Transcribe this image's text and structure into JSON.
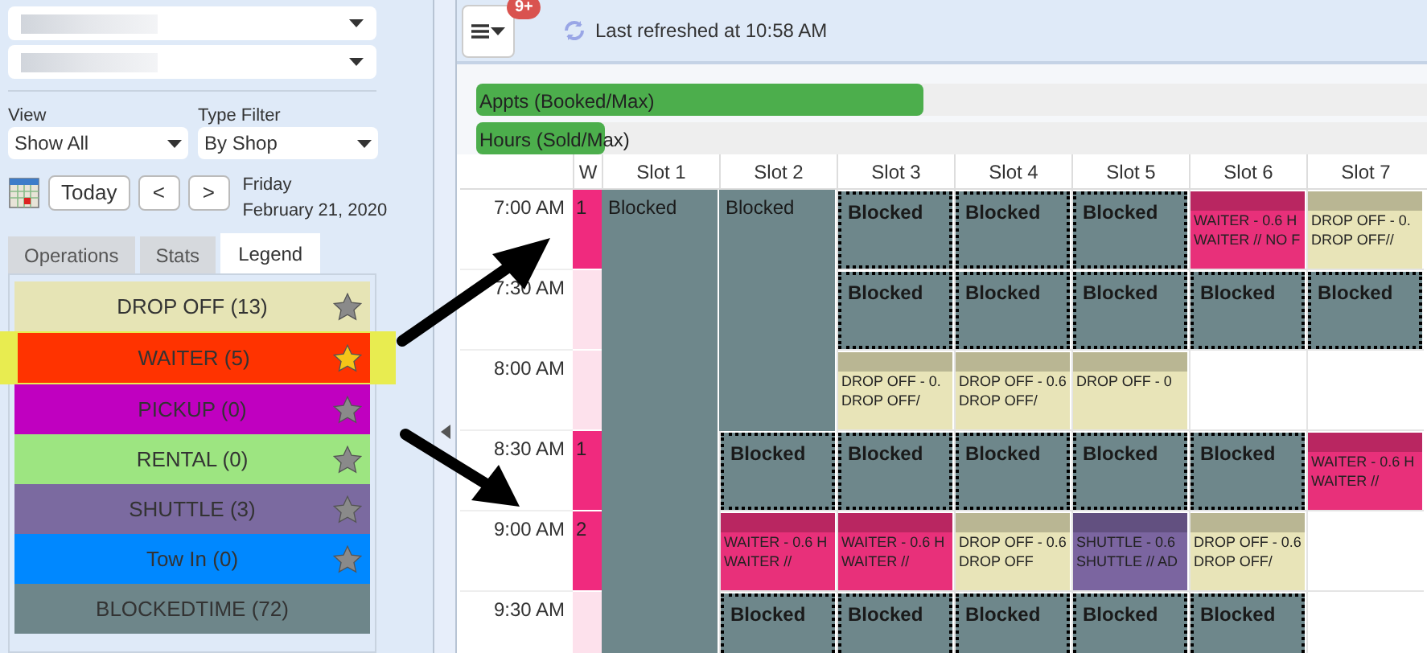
{
  "sidebar": {
    "dropdowns": [
      {
        "kind": "blurred"
      },
      {
        "kind": "blurred"
      }
    ],
    "view": {
      "label": "View",
      "value": "Show All"
    },
    "type_filter": {
      "label": "Type Filter",
      "value": "By Shop"
    },
    "date_nav": {
      "today": "Today",
      "prev": "<",
      "next": ">",
      "weekday": "Friday",
      "date": "February 21, 2020"
    },
    "tabs": [
      {
        "label": "Operations",
        "selected": false
      },
      {
        "label": "Stats",
        "selected": false
      },
      {
        "label": "Legend",
        "selected": true
      }
    ],
    "legend": [
      {
        "label": "DROP OFF (13)",
        "color": "#e6e4b5",
        "kind": "type",
        "starred": false,
        "highlighted": false
      },
      {
        "label": "WAITER (5)",
        "color": "#ff3300",
        "kind": "type",
        "starred": true,
        "highlighted": true
      },
      {
        "label": "PICKUP (0)",
        "color": "#c000c0",
        "kind": "type",
        "starred": false,
        "highlighted": false
      },
      {
        "label": "RENTAL (0)",
        "color": "#9de581",
        "kind": "type",
        "starred": false,
        "highlighted": false
      },
      {
        "label": "SHUTTLE (3)",
        "color": "#7b6aa0",
        "kind": "type",
        "starred": false,
        "highlighted": false
      },
      {
        "label": "Tow In (0)",
        "color": "#0088ff",
        "kind": "type",
        "starred": false,
        "highlighted": false
      },
      {
        "label": "BLOCKEDTIME (72)",
        "color": "#6e868a",
        "kind": "blocked",
        "highlighted": false
      }
    ]
  },
  "toolbar": {
    "badge": "9+",
    "refreshed": "Last refreshed at 10:58 AM"
  },
  "capacity": [
    {
      "label": "Appts (Booked/Max)",
      "level": 0.47
    },
    {
      "label": "Hours (Sold/Max)",
      "level": 0.135
    }
  ],
  "schedule": {
    "w_header": "W",
    "slots": [
      "Slot 1",
      "Slot 2",
      "Slot 3",
      "Slot 4",
      "Slot 5",
      "Slot 6",
      "Slot 7"
    ],
    "rows": [
      {
        "time": "7:00 AM",
        "w": {
          "text": "1",
          "booked": true
        }
      },
      {
        "time": "7:30 AM",
        "w": {
          "booked": false
        }
      },
      {
        "time": "8:00 AM",
        "w": {
          "booked": false
        }
      },
      {
        "time": "8:30 AM",
        "w": {
          "text": "1",
          "booked": true
        }
      },
      {
        "time": "9:00 AM",
        "w": {
          "text": "2",
          "booked": true
        }
      },
      {
        "time": "9:30 AM",
        "w": {
          "booked": false
        }
      }
    ],
    "columns": [
      [
        {
          "kind": "block",
          "text": "Blocked",
          "dashed": false
        },
        {
          "kind": "continued"
        },
        {
          "kind": "continued"
        },
        {
          "kind": "continued"
        },
        {
          "kind": "continued"
        },
        {
          "kind": "continued"
        }
      ],
      [
        {
          "kind": "block",
          "text": "Blocked",
          "dashed": false
        },
        {
          "kind": "continued"
        },
        {
          "kind": "continued"
        },
        {
          "kind": "block",
          "text": "Blocked",
          "dashed": true
        },
        {
          "kind": "appointment",
          "color": "#e8307a",
          "lines": [
            "WAITER - 0.6 H",
            "WAITER //"
          ]
        },
        {
          "kind": "block",
          "text": "Blocked",
          "dashed": true
        }
      ],
      [
        {
          "kind": "block",
          "text": "Blocked",
          "dashed": true
        },
        {
          "kind": "block",
          "text": "Blocked",
          "dashed": true
        },
        {
          "kind": "appointment",
          "color": "#e8e4b8",
          "lines": [
            "DROP OFF - 0.",
            "DROP OFF/"
          ]
        },
        {
          "kind": "block",
          "text": "Blocked",
          "dashed": true
        },
        {
          "kind": "appointment",
          "color": "#e8307a",
          "lines": [
            "WAITER - 0.6 H",
            "WAITER //"
          ]
        },
        {
          "kind": "block",
          "text": "Blocked",
          "dashed": true
        }
      ],
      [
        {
          "kind": "block",
          "text": "Blocked",
          "dashed": true
        },
        {
          "kind": "block",
          "text": "Blocked",
          "dashed": true
        },
        {
          "kind": "appointment",
          "color": "#e8e4b8",
          "lines": [
            "DROP OFF - 0.6",
            "DROP OFF/"
          ]
        },
        {
          "kind": "block",
          "text": "Blocked",
          "dashed": true
        },
        {
          "kind": "appointment",
          "color": "#e8e4b8",
          "lines": [
            "DROP OFF - 0.6",
            "DROP OFF"
          ]
        },
        {
          "kind": "block",
          "text": "Blocked",
          "dashed": true
        }
      ],
      [
        {
          "kind": "block",
          "text": "Blocked",
          "dashed": true
        },
        {
          "kind": "block",
          "text": "Blocked",
          "dashed": true
        },
        {
          "kind": "appointment",
          "color": "#e8e4b8",
          "lines": [
            "DROP OFF - 0"
          ]
        },
        {
          "kind": "block",
          "text": "Blocked",
          "dashed": true
        },
        {
          "kind": "appointment",
          "color": "#7b65a0",
          "lines": [
            "SHUTTLE - 0.6",
            "SHUTTLE // AD"
          ]
        },
        {
          "kind": "block",
          "text": "Blocked",
          "dashed": true
        }
      ],
      [
        {
          "kind": "appointment",
          "color": "#e8307a",
          "lines": [
            "WAITER - 0.6 H",
            "WAITER // NO F"
          ]
        },
        {
          "kind": "block",
          "text": "Blocked",
          "dashed": true
        },
        {
          "kind": "empty"
        },
        {
          "kind": "block",
          "text": "Blocked",
          "dashed": true
        },
        {
          "kind": "appointment",
          "color": "#e8e4b8",
          "lines": [
            "DROP OFF - 0.6",
            "DROP OFF/"
          ]
        },
        {
          "kind": "block",
          "text": "Blocked",
          "dashed": true
        }
      ],
      [
        {
          "kind": "appointment",
          "color": "#e8e4b8",
          "lines": [
            "DROP OFF - 0.",
            "DROP OFF//"
          ]
        },
        {
          "kind": "block",
          "text": "Blocked",
          "dashed": true
        },
        {
          "kind": "empty"
        },
        {
          "kind": "appointment",
          "color": "#e8307a",
          "lines": [
            "WAITER - 0.6 H",
            "WAITER //"
          ]
        },
        {
          "kind": "empty"
        },
        {
          "kind": "empty"
        }
      ]
    ]
  }
}
